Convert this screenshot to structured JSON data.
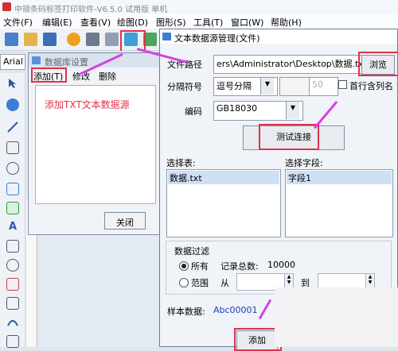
{
  "app": {
    "title": "中琅条码标签打印软件-V6.5.0 试用版 单机",
    "menus": [
      "文件(F)",
      "编辑(E)",
      "查看(V)",
      "绘图(D)",
      "图形(S)",
      "工具(T)",
      "窗口(W)",
      "帮助(H)"
    ],
    "font_name": "Arial"
  },
  "datasource_window": {
    "title": "数据库设置",
    "menu_add": "添加(T)",
    "menu_edit": "修改",
    "menu_delete": "删除",
    "annotation": "添加TXT文本数据源",
    "close_label": "关闭"
  },
  "dialog": {
    "title": "文本数据源管理(文件)",
    "file_path_label": "文件路径",
    "file_path_value": "ers\\Administrator\\Desktop\\数据.txt",
    "browse_label": "浏览",
    "separator_label": "分隔符号",
    "separator_value": "逗号分隔",
    "separator_count": "50",
    "first_row_label": "首行含列名",
    "encoding_label": "编码",
    "encoding_value": "GB18030",
    "test_button": "测试连接",
    "select_table_label": "选择表:",
    "table_item": "数据.txt",
    "select_field_label": "选择字段:",
    "field_item": "字段1",
    "filter_group_label": "数据过滤",
    "radio_all": "所有",
    "total_label": "记录总数:",
    "total_value": "10000",
    "radio_range": "范围",
    "range_from": "从",
    "range_to": "到",
    "sample_label": "样本数据:",
    "sample_value": "Abc00001",
    "add_button": "添加"
  },
  "colors": {
    "highlight": "#e0314a",
    "arrow": "#d641e6",
    "selection": "#cfe0f6"
  }
}
